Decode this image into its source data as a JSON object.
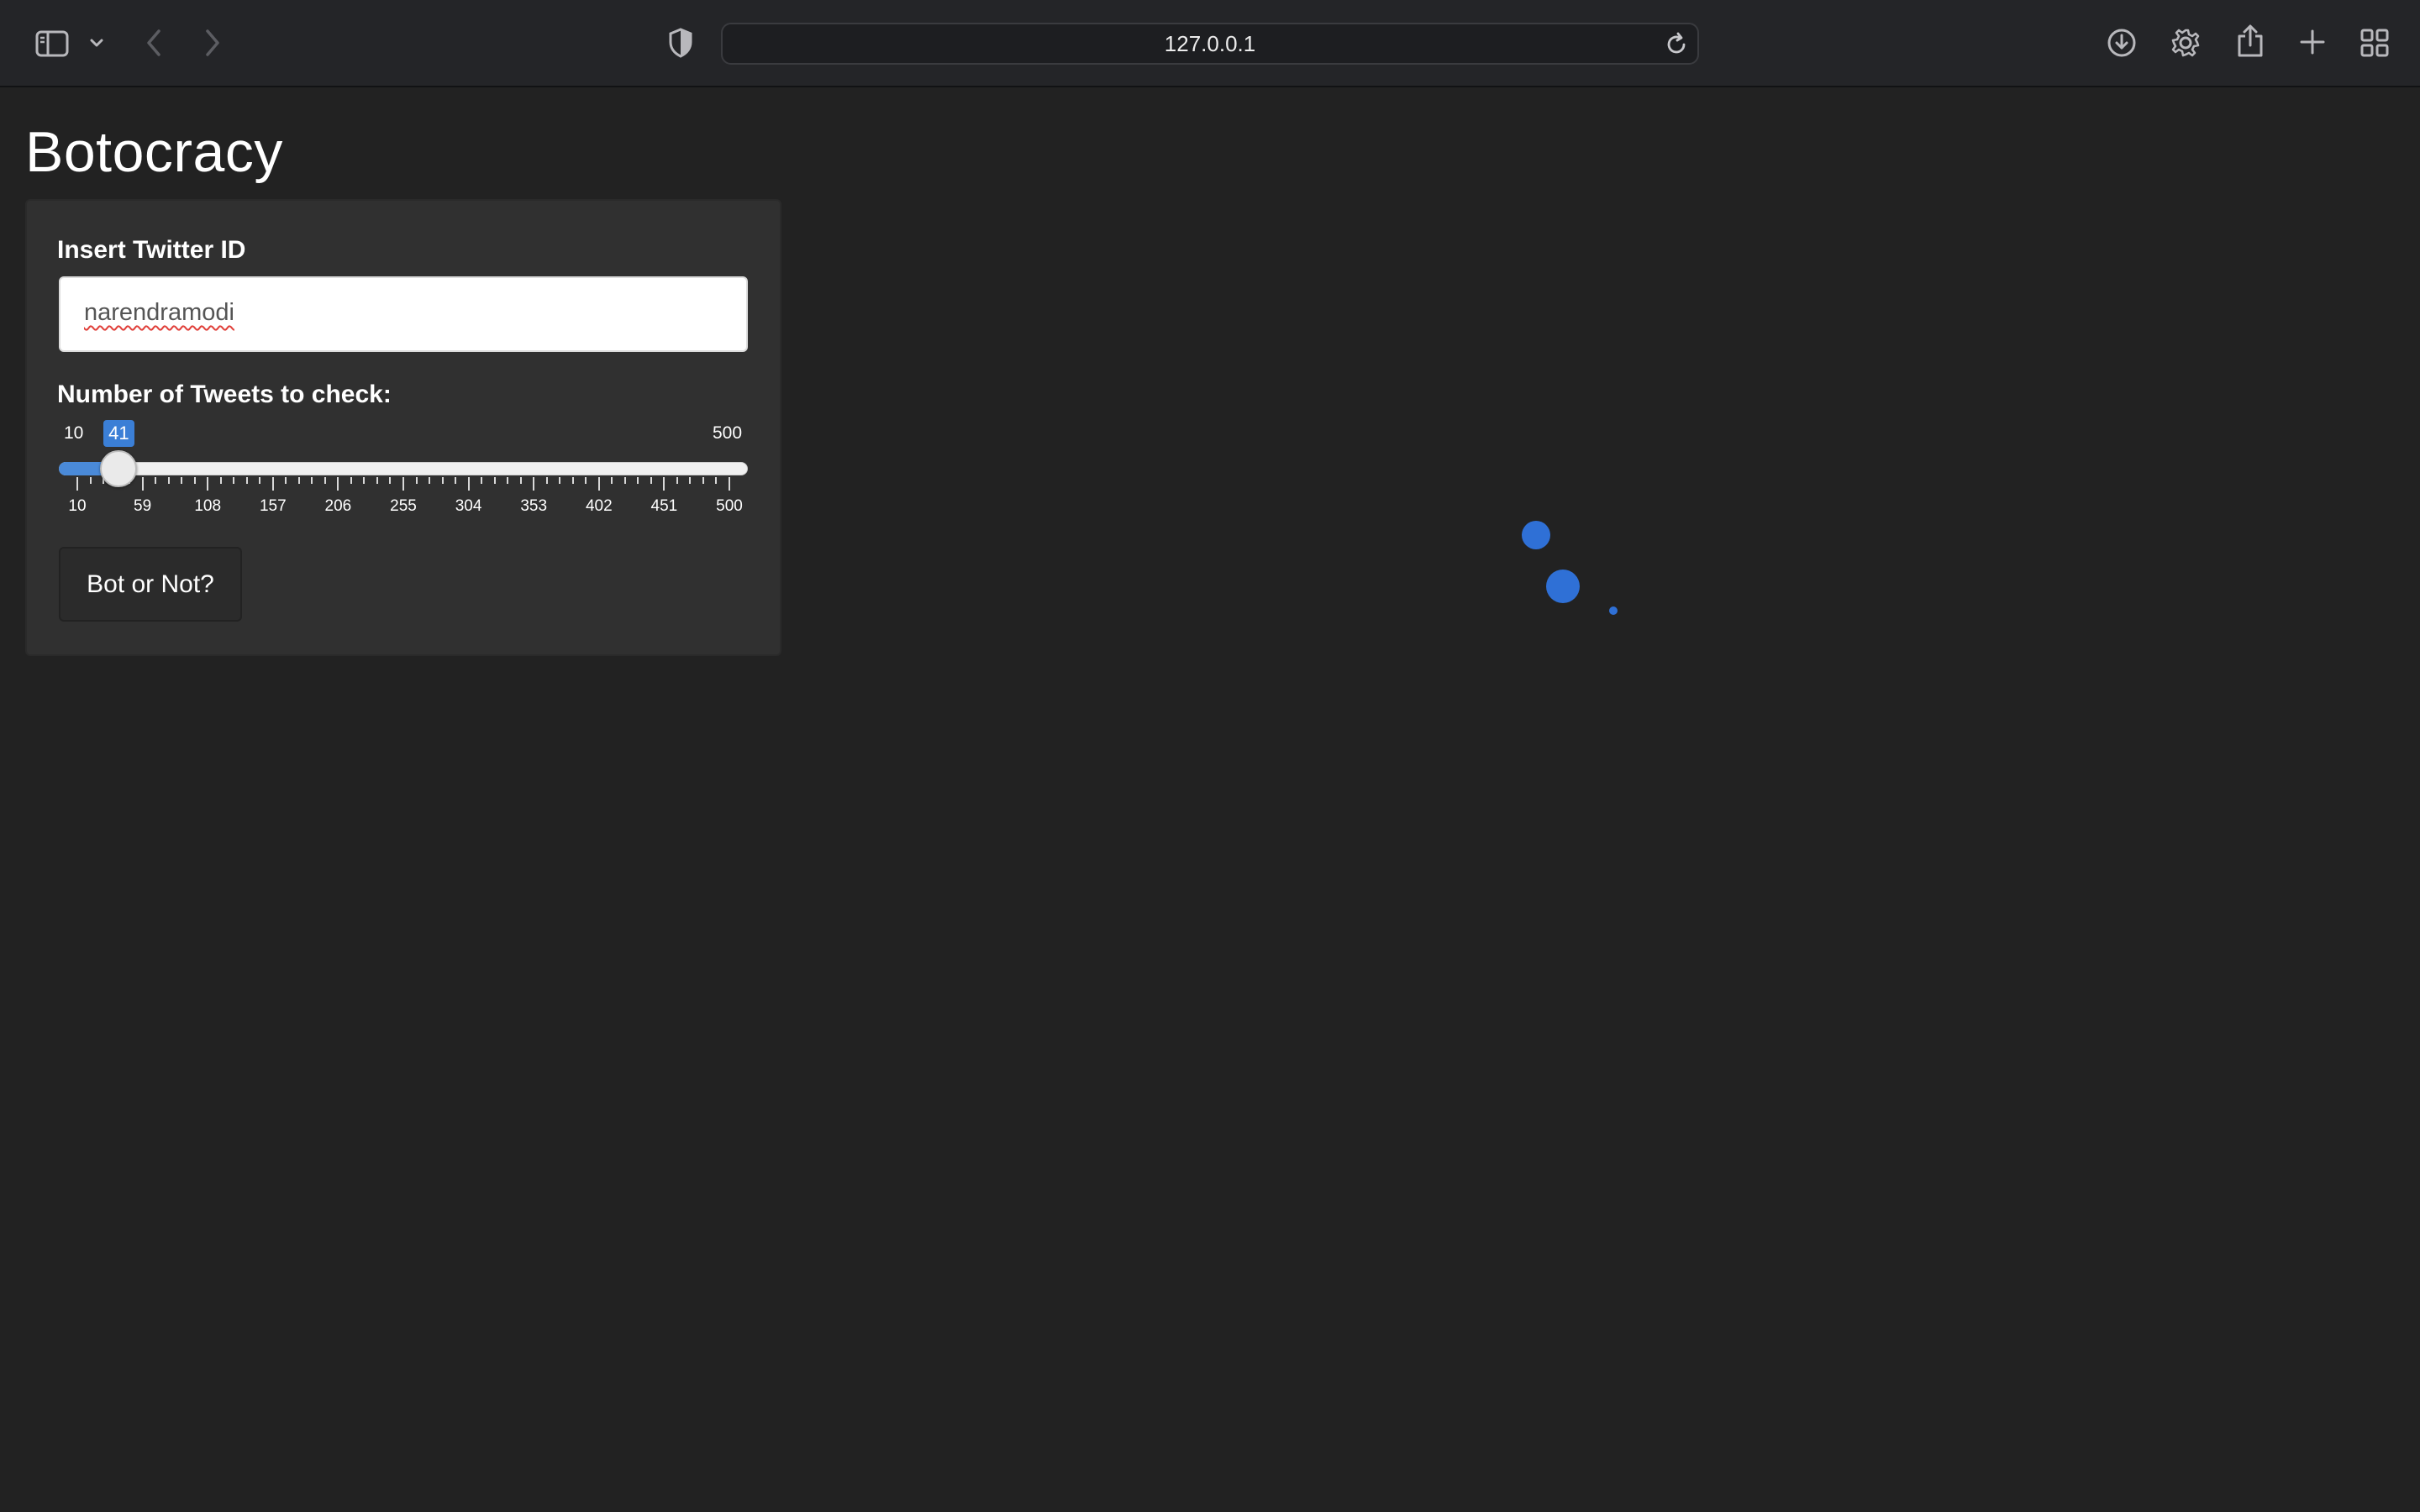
{
  "browser": {
    "address": "127.0.0.1",
    "icons": {
      "sidebar": "sidebar-icon",
      "chevron": "chevron-down-icon",
      "back": "back-arrow-icon",
      "forward": "forward-arrow-icon",
      "privacy": "shield-icon",
      "reload": "reload-icon",
      "downloads": "download-icon",
      "settings": "gear-icon",
      "share": "share-icon",
      "new_tab": "plus-icon",
      "tab_overview": "grid-icon"
    }
  },
  "app": {
    "title": "Botocracy",
    "twitter_field": {
      "label": "Insert Twitter ID",
      "value": "narendramodi"
    },
    "tweets_slider": {
      "label": "Number of Tweets to check:",
      "min_label": "10",
      "max_label": "500",
      "value": "41",
      "min": 10,
      "max": 500,
      "current": 41,
      "ticks": [
        "10",
        "59",
        "108",
        "157",
        "206",
        "255",
        "304",
        "353",
        "402",
        "451",
        "500"
      ]
    },
    "submit_label": "Bot or Not?"
  },
  "colors": {
    "background": "#222222",
    "panel": "#303030",
    "accent": "#3b7fd6",
    "spinner": "#2f70d6"
  }
}
